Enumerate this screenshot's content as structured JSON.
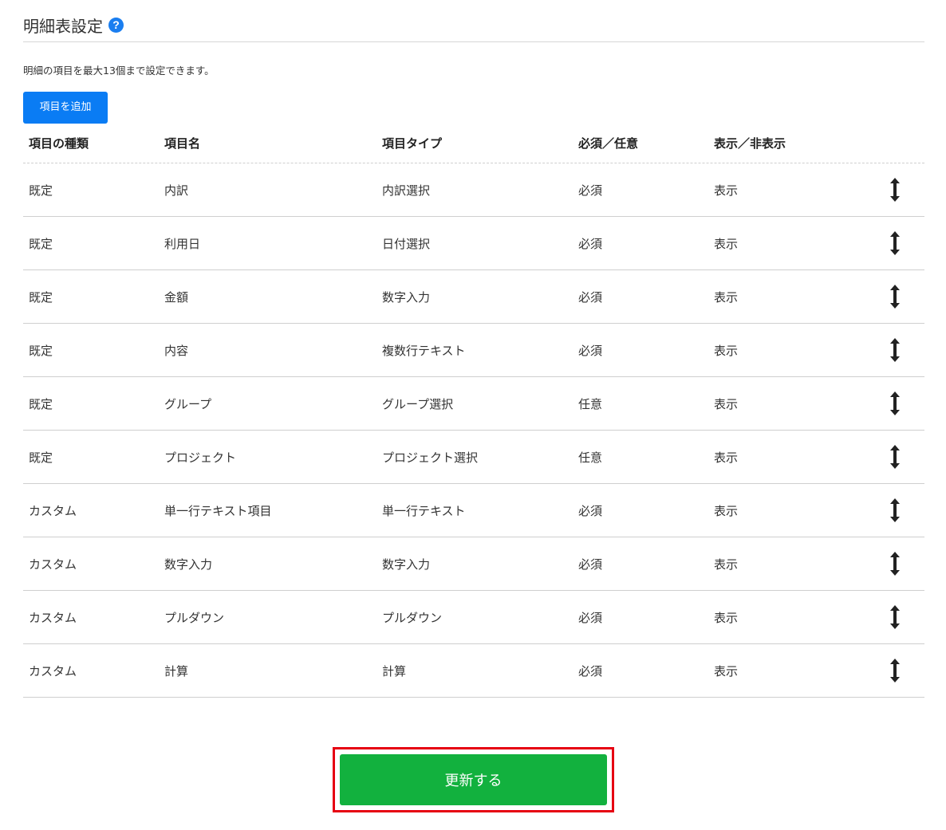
{
  "header": {
    "title": "明細表設定",
    "help_icon": "?"
  },
  "description": "明細の項目を最大13個まで設定できます。",
  "add_button_label": "項目を追加",
  "table": {
    "columns": [
      "項目の種類",
      "項目名",
      "項目タイプ",
      "必須／任意",
      "表示／非表示"
    ],
    "rows": [
      {
        "kind": "既定",
        "name": "内訳",
        "type": "内訳選択",
        "required": "必須",
        "display": "表示"
      },
      {
        "kind": "既定",
        "name": "利用日",
        "type": "日付選択",
        "required": "必須",
        "display": "表示"
      },
      {
        "kind": "既定",
        "name": "金額",
        "type": "数字入力",
        "required": "必須",
        "display": "表示"
      },
      {
        "kind": "既定",
        "name": "内容",
        "type": "複数行テキスト",
        "required": "必須",
        "display": "表示"
      },
      {
        "kind": "既定",
        "name": "グループ",
        "type": "グループ選択",
        "required": "任意",
        "display": "表示"
      },
      {
        "kind": "既定",
        "name": "プロジェクト",
        "type": "プロジェクト選択",
        "required": "任意",
        "display": "表示"
      },
      {
        "kind": "カスタム",
        "name": "単一行テキスト項目",
        "type": "単一行テキスト",
        "required": "必須",
        "display": "表示"
      },
      {
        "kind": "カスタム",
        "name": "数字入力",
        "type": "数字入力",
        "required": "必須",
        "display": "表示"
      },
      {
        "kind": "カスタム",
        "name": "プルダウン",
        "type": "プルダウン",
        "required": "必須",
        "display": "表示"
      },
      {
        "kind": "カスタム",
        "name": "計算",
        "type": "計算",
        "required": "必須",
        "display": "表示"
      }
    ]
  },
  "update_button_label": "更新する",
  "colors": {
    "add_button": "#0a7cf4",
    "update_button": "#12b13e",
    "highlight_border": "#e60012",
    "help_icon": "#1a7ef0"
  },
  "icons": {
    "help": "question-circle-icon",
    "drag": "vertical-arrows-drag-icon"
  }
}
